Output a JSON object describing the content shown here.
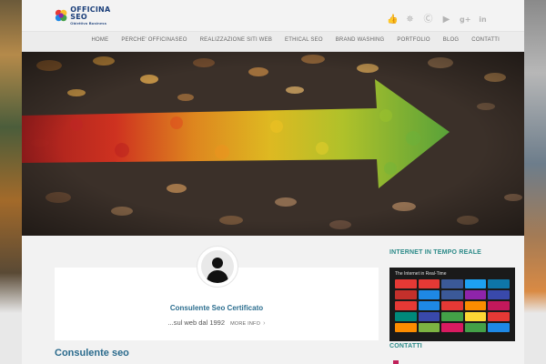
{
  "header": {
    "logo": {
      "name": "OFFICINA SEO",
      "tagline": "Obiettivo Business"
    },
    "social_icons": [
      "thumbs-up-icon",
      "twitter-icon",
      "skype-icon",
      "youtube-icon",
      "google-plus-icon",
      "linkedin-icon"
    ]
  },
  "nav": {
    "items": [
      "HOME",
      "PERCHE' OFFICINASEO",
      "REALIZZAZIONE SITI WEB",
      "ETHICAL SEO",
      "BRAND WASHING",
      "PORTFOLIO",
      "BLOG",
      "CONTATTI"
    ]
  },
  "hero": {
    "image": "autumn-leaves-arrow"
  },
  "card": {
    "title": "Consulente Seo Certificato",
    "subtitle": "...sul web dal 1992",
    "more_label": "MORE INFO",
    "chevron": "›"
  },
  "main": {
    "section_title": "Consulente seo"
  },
  "sidebar": {
    "widget_title": "INTERNET IN TEMPO REALE",
    "widget_caption": "The Internet in Real-Time",
    "contacts_title": "CONTATTI"
  },
  "colors": {
    "accent_teal": "#2c8a88",
    "link_blue": "#2c6e8f",
    "nav_text": "#666666"
  }
}
